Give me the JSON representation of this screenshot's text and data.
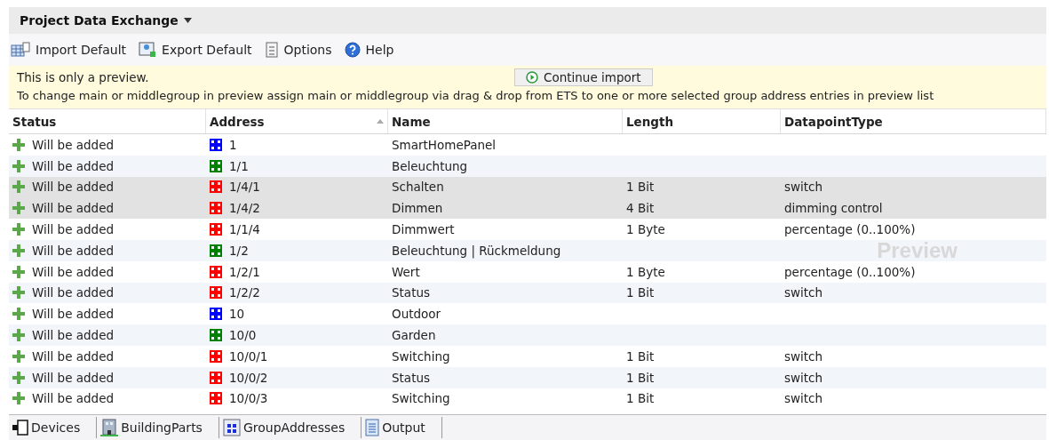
{
  "title": "Project Data Exchange",
  "toolbar": [
    {
      "kind": "import",
      "label": "Import Default"
    },
    {
      "kind": "export",
      "label": "Export Default"
    },
    {
      "kind": "options",
      "label": "Options"
    },
    {
      "kind": "help",
      "label": "Help"
    }
  ],
  "banner": {
    "message": "This is only a preview.",
    "button": "Continue import",
    "hint": "To change main or middlegroup in preview assign main or middlegroup via drag & drop from ETS to one or more selected group address entries in preview list"
  },
  "columns": [
    "Status",
    "Address",
    "Name",
    "Length",
    "DatapointType"
  ],
  "rows": [
    {
      "status": "Will be added",
      "address": "1",
      "color": "#0000ff",
      "name": "SmartHomePanel",
      "length": "",
      "type": "",
      "selected": false
    },
    {
      "status": "Will be added",
      "address": "1/1",
      "color": "#008000",
      "name": "Beleuchtung",
      "length": "",
      "type": "",
      "selected": false
    },
    {
      "status": "Will be added",
      "address": "1/4/1",
      "color": "#ff0000",
      "name": "Schalten",
      "length": "1 Bit",
      "type": "switch",
      "selected": true
    },
    {
      "status": "Will be added",
      "address": "1/4/2",
      "color": "#ff0000",
      "name": "Dimmen",
      "length": "4 Bit",
      "type": "dimming control",
      "selected": true
    },
    {
      "status": "Will be added",
      "address": "1/1/4",
      "color": "#ff0000",
      "name": "Dimmwert",
      "length": "1 Byte",
      "type": "percentage (0..100%)",
      "selected": false
    },
    {
      "status": "Will be added",
      "address": "1/2",
      "color": "#008000",
      "name": "Beleuchtung | Rückmeldung",
      "length": "",
      "type": "",
      "selected": false
    },
    {
      "status": "Will be added",
      "address": "1/2/1",
      "color": "#ff0000",
      "name": "Wert",
      "length": "1 Byte",
      "type": "percentage (0..100%)",
      "selected": false
    },
    {
      "status": "Will be added",
      "address": "1/2/2",
      "color": "#ff0000",
      "name": "Status",
      "length": "1 Bit",
      "type": "switch",
      "selected": false
    },
    {
      "status": "Will be added",
      "address": "10",
      "color": "#0000ff",
      "name": "Outdoor",
      "length": "",
      "type": "",
      "selected": false
    },
    {
      "status": "Will be added",
      "address": "10/0",
      "color": "#008000",
      "name": "Garden",
      "length": "",
      "type": "",
      "selected": false
    },
    {
      "status": "Will be added",
      "address": "10/0/1",
      "color": "#ff0000",
      "name": "Switching",
      "length": "1 Bit",
      "type": "switch",
      "selected": false
    },
    {
      "status": "Will be added",
      "address": "10/0/2",
      "color": "#ff0000",
      "name": "Status",
      "length": "1 Bit",
      "type": "switch",
      "selected": false
    },
    {
      "status": "Will be added",
      "address": "10/0/3",
      "color": "#ff0000",
      "name": "Switching",
      "length": "1 Bit",
      "type": "switch",
      "selected": false
    }
  ],
  "watermark": "Preview",
  "tabs": [
    {
      "kind": "devices",
      "label": "Devices"
    },
    {
      "kind": "building",
      "label": "BuildingParts"
    },
    {
      "kind": "groups",
      "label": "GroupAddresses"
    },
    {
      "kind": "output",
      "label": "Output"
    }
  ]
}
